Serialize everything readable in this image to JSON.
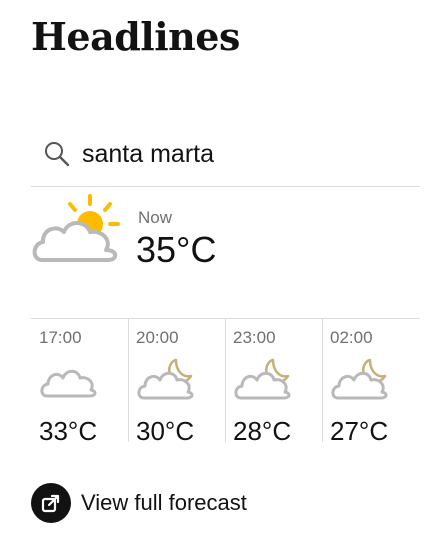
{
  "page": {
    "title": "Headlines"
  },
  "search": {
    "query": "santa marta",
    "icon": "search-icon"
  },
  "current": {
    "label": "Now",
    "temperature": "35°C",
    "icon": "partly-sunny-icon",
    "colors": {
      "sun": "#ffbb00",
      "cloud_outline": "#b9b9b9"
    }
  },
  "hourly": [
    {
      "time": "17:00",
      "temperature": "33°C",
      "icon": "cloudy-icon"
    },
    {
      "time": "20:00",
      "temperature": "30°C",
      "icon": "cloudy-night-icon"
    },
    {
      "time": "23:00",
      "temperature": "28°C",
      "icon": "cloudy-night-icon"
    },
    {
      "time": "02:00",
      "temperature": "27°C",
      "icon": "cloudy-night-icon"
    }
  ],
  "forecast_link": {
    "label": "View full forecast",
    "icon": "external-link-icon"
  }
}
